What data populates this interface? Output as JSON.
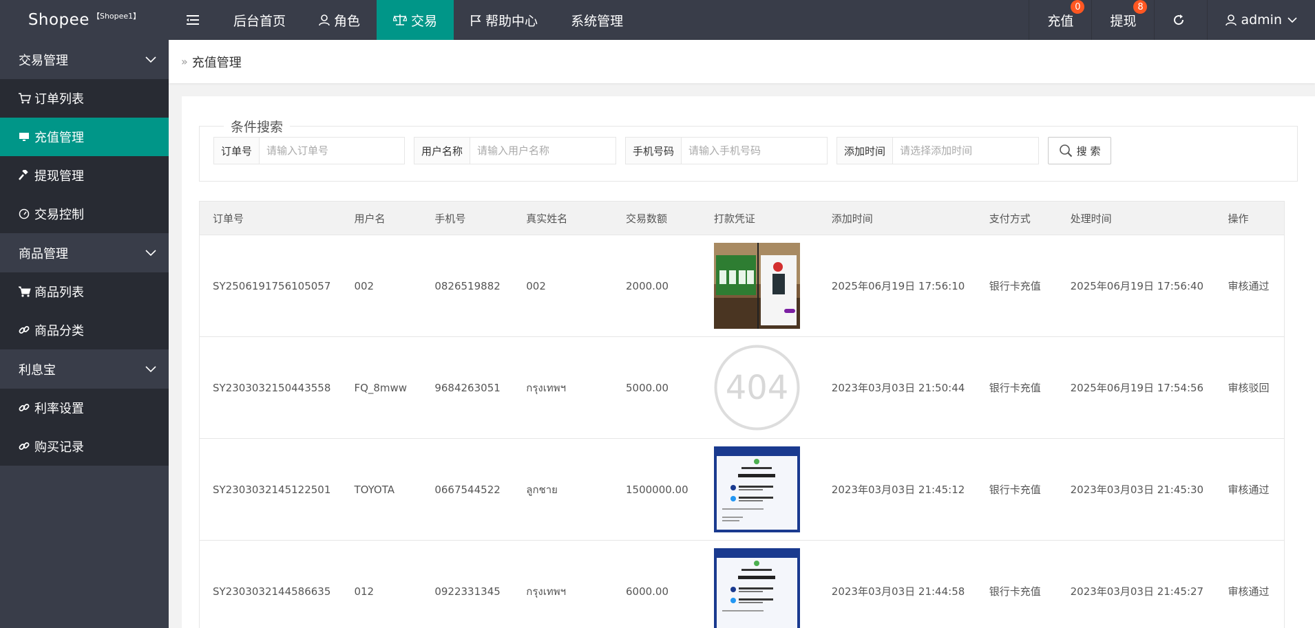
{
  "brand": {
    "name": "Shopee",
    "tag": "【Shopee1】"
  },
  "nav": {
    "items": [
      {
        "label": "后台首页"
      },
      {
        "label": "角色"
      },
      {
        "label": "交易"
      },
      {
        "label": "帮助中心"
      },
      {
        "label": "系统管理"
      }
    ],
    "active": "交易"
  },
  "topright": {
    "recharge": {
      "label": "充值",
      "badge": "0"
    },
    "withdraw": {
      "label": "提现",
      "badge": "8"
    },
    "user": "admin"
  },
  "sidebar": {
    "groups": [
      {
        "label": "交易管理",
        "items": [
          "订单列表",
          "充值管理",
          "提现管理",
          "交易控制"
        ]
      },
      {
        "label": "商品管理",
        "items": [
          "商品列表",
          "商品分类"
        ]
      },
      {
        "label": "利息宝",
        "items": [
          "利率设置",
          "购买记录"
        ]
      }
    ],
    "active": "充值管理"
  },
  "breadcrumb": {
    "arrows": "»",
    "title": "充值管理"
  },
  "search": {
    "legend": "条件搜索",
    "order": {
      "label": "订单号",
      "placeholder": "请输入订单号"
    },
    "username": {
      "label": "用户名称",
      "placeholder": "请输入用户名称"
    },
    "phone": {
      "label": "手机号码",
      "placeholder": "请输入手机号码"
    },
    "time": {
      "label": "添加时间",
      "placeholder": "请选择添加时间"
    },
    "button": "搜 索"
  },
  "table": {
    "headers": [
      "订单号",
      "用户名",
      "手机号",
      "真实姓名",
      "交易数额",
      "打款凭证",
      "添加时间",
      "支付方式",
      "处理时间",
      "操作"
    ],
    "rows": [
      {
        "order": "SY2506191756105057",
        "user": "002",
        "phone": "0826519882",
        "realname": "002",
        "amount": "2000.00",
        "proof": "screenshot",
        "added": "2025年06月19日 17:56:10",
        "pay": "银行卡充值",
        "processed": "2025年06月19日 17:56:40",
        "action": "审核通过"
      },
      {
        "order": "SY2303032150443558",
        "user": "FQ_8mww",
        "phone": "9684263051",
        "realname": "กรุงเทพฯ",
        "amount": "5000.00",
        "proof": "404",
        "added": "2023年03月03日 21:50:44",
        "pay": "银行卡充值",
        "processed": "2025年06月19日 17:54:56",
        "action": "审核驳回"
      },
      {
        "order": "SY2303032145122501",
        "user": "TOYOTA",
        "phone": "0667544522",
        "realname": "ลูกชาย",
        "amount": "1500000.00",
        "proof": "receipt",
        "added": "2023年03月03日 21:45:12",
        "pay": "银行卡充值",
        "processed": "2023年03月03日 21:45:30",
        "action": "审核通过"
      },
      {
        "order": "SY2303032144586635",
        "user": "012",
        "phone": "0922331345",
        "realname": "กรุงเทพฯ",
        "amount": "6000.00",
        "proof": "receipt",
        "added": "2023年03月03日 21:44:58",
        "pay": "银行卡充值",
        "processed": "2023年03月03日 21:45:27",
        "action": "审核通过"
      }
    ]
  },
  "colors": {
    "dark": "#393d49",
    "darker": "#282b33",
    "accent": "#009688",
    "badge": "#ff5722"
  }
}
